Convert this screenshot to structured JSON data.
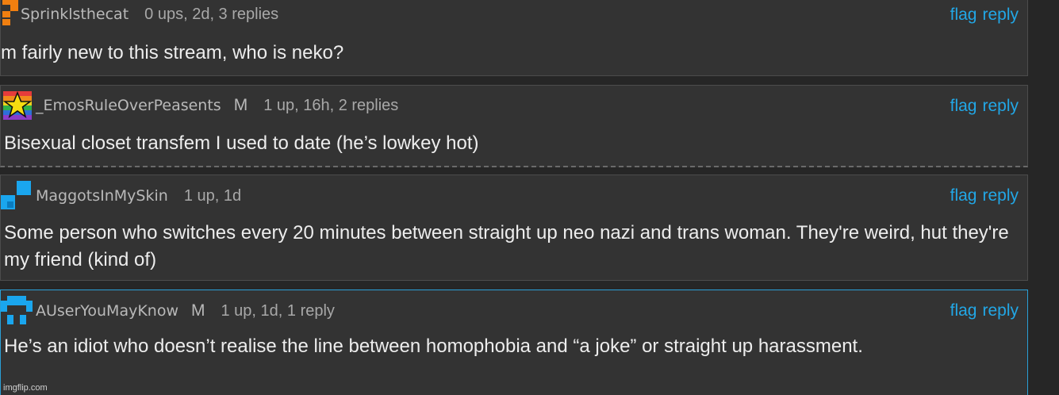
{
  "actions": {
    "flag_label": "flag",
    "reply_label": "reply"
  },
  "comments": [
    {
      "username": "Sprinklsthecat",
      "stats": "0 ups, 2d, 3 replies",
      "body": "m fairly new to this stream, who is neko?",
      "avatar_icon": "orange-pixel-avatar-icon"
    },
    {
      "username": "_EmosRuleOverPeasents",
      "mod_badge": "M",
      "stats": "1 up, 16h, 2 replies",
      "body": "Bisexual closet transfem I used to date (he’s lowkey hot)",
      "avatar_icon": "rainbow-star-avatar-icon"
    },
    {
      "username": "MaggotsInMySkin",
      "stats": "1 up, 1d",
      "body": "Some person who switches every 20 minutes between straight up neo nazi and trans woman. They're weird, hut they're my friend (kind of)",
      "avatar_icon": "blue-pixel-avatar-icon"
    },
    {
      "username": "AUserYouMayKnow",
      "mod_badge": "M",
      "stats": "1 up, 1d, 1 reply",
      "body": "He’s an idiot who doesn’t realise the line between homophobia and “a joke” or straight up harassment.",
      "avatar_icon": "cyan-pixel-avatar-icon"
    }
  ],
  "watermark": "imgflip.com",
  "colors": {
    "background": "#262626",
    "comment_bg": "#333333",
    "link": "#22a7e6",
    "highlight_border": "#2a9fd6",
    "text": "#ededed",
    "meta": "#b9b9b9"
  }
}
